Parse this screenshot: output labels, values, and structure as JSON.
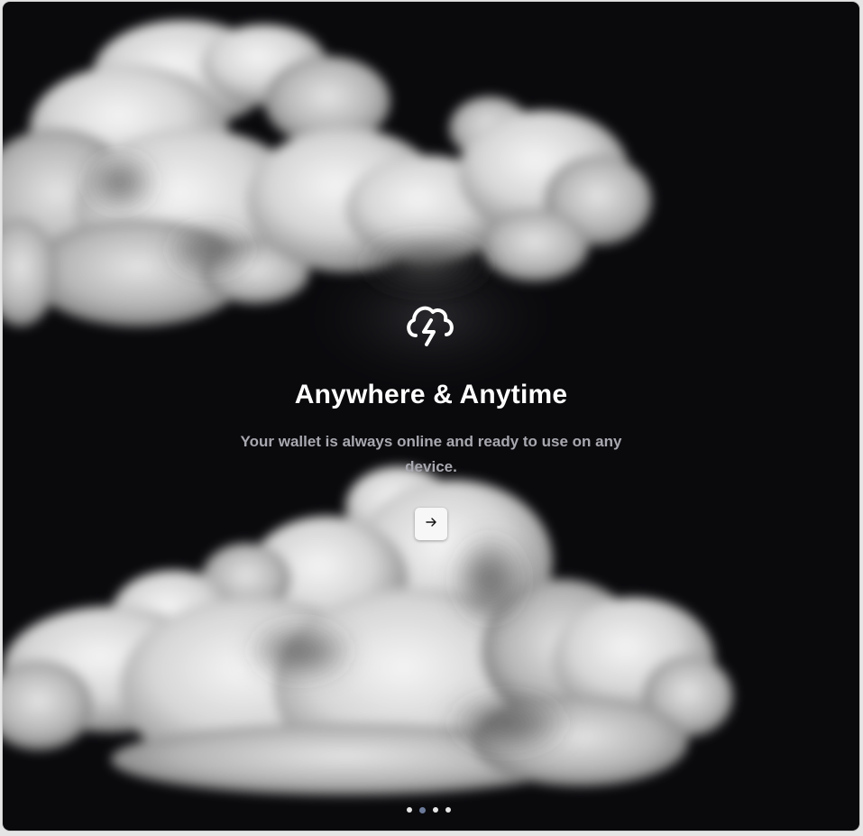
{
  "slide": {
    "icon": "cloud-lightning-icon",
    "title": "Anywhere & Anytime",
    "subtitle": "Your wallet is always online and ready to use on any device.",
    "next_icon": "arrow-right-icon"
  },
  "pagination": {
    "total": 4,
    "active_index": 1
  },
  "colors": {
    "background": "#0a0a0d",
    "title": "#ffffff",
    "subtitle": "#a8a8b0",
    "button_bg": "#f7f7f7",
    "dot_active": "#6b7a99",
    "dot_inactive": "#e6e6e6"
  }
}
